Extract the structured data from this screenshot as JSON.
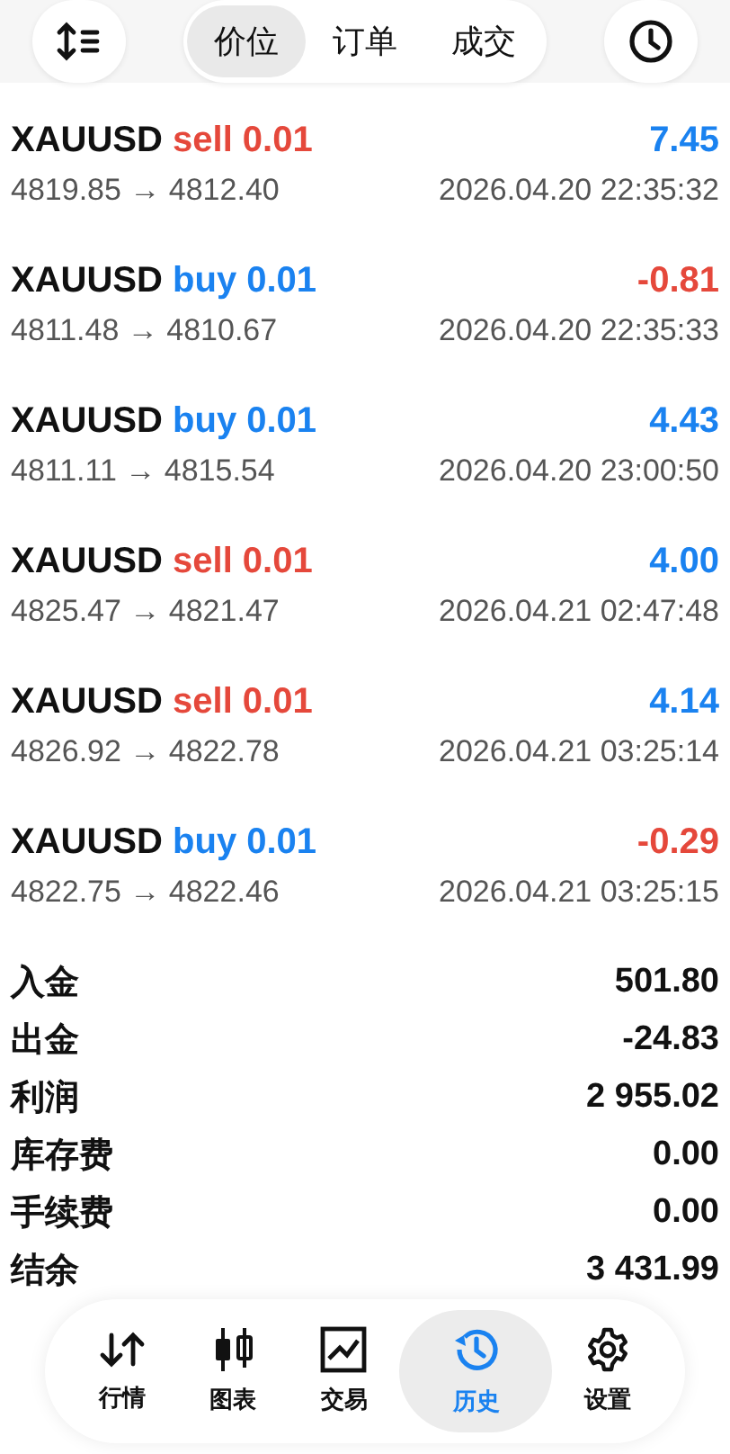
{
  "top_bar": {
    "tabs": [
      {
        "label": "价位",
        "selected": true
      },
      {
        "label": "订单",
        "selected": false
      },
      {
        "label": "成交",
        "selected": false
      }
    ]
  },
  "deals": [
    {
      "symbol": "XAUUSD",
      "side": "sell",
      "volume": "0.01",
      "profit": "7.45",
      "profit_positive": true,
      "prices": "4819.85 → 4812.40",
      "time": "2026.04.20 22:35:32"
    },
    {
      "symbol": "XAUUSD",
      "side": "buy",
      "volume": "0.01",
      "profit": "-0.81",
      "profit_positive": false,
      "prices": "4811.48 → 4810.67",
      "time": "2026.04.20 22:35:33"
    },
    {
      "symbol": "XAUUSD",
      "side": "buy",
      "volume": "0.01",
      "profit": "4.43",
      "profit_positive": true,
      "prices": "4811.11 → 4815.54",
      "time": "2026.04.20 23:00:50"
    },
    {
      "symbol": "XAUUSD",
      "side": "sell",
      "volume": "0.01",
      "profit": "4.00",
      "profit_positive": true,
      "prices": "4825.47 → 4821.47",
      "time": "2026.04.21 02:47:48"
    },
    {
      "symbol": "XAUUSD",
      "side": "sell",
      "volume": "0.01",
      "profit": "4.14",
      "profit_positive": true,
      "prices": "4826.92 → 4822.78",
      "time": "2026.04.21 03:25:14"
    },
    {
      "symbol": "XAUUSD",
      "side": "buy",
      "volume": "0.01",
      "profit": "-0.29",
      "profit_positive": false,
      "prices": "4822.75 → 4822.46",
      "time": "2026.04.21 03:25:15"
    }
  ],
  "summary": [
    {
      "label": "入金",
      "value": "501.80"
    },
    {
      "label": "出金",
      "value": "-24.83"
    },
    {
      "label": "利润",
      "value": "2 955.02"
    },
    {
      "label": "库存费",
      "value": "0.00"
    },
    {
      "label": "手续费",
      "value": "0.00"
    },
    {
      "label": "结余",
      "value": "3 431.99"
    }
  ],
  "bottom_nav": [
    {
      "kind": "quotes",
      "label": "行情",
      "selected": false
    },
    {
      "kind": "chart",
      "label": "图表",
      "selected": false
    },
    {
      "kind": "trade",
      "label": "交易",
      "selected": false
    },
    {
      "kind": "history",
      "label": "历史",
      "selected": true
    },
    {
      "kind": "settings",
      "label": "设置",
      "selected": false
    }
  ]
}
